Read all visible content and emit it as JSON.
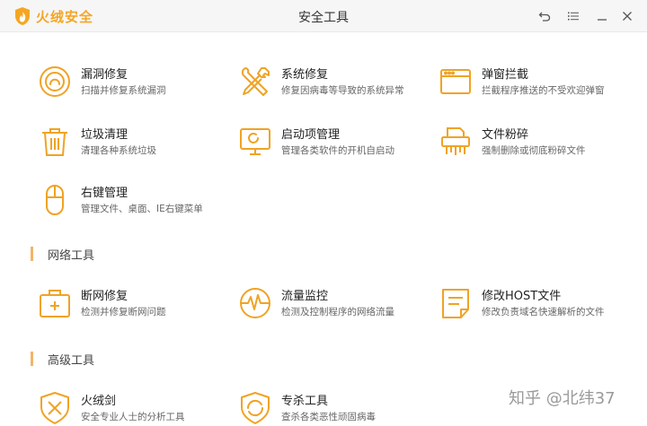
{
  "app": {
    "brand": "火绒安全",
    "title": "安全工具"
  },
  "colors": {
    "accent": "#f5a623",
    "icon_stroke": "#f0a324",
    "section_bar": "#f0b66a"
  },
  "window_controls": [
    "back-icon",
    "menu-icon",
    "minimize-icon",
    "close-icon"
  ],
  "sections": {
    "system": {
      "items": [
        {
          "name": "漏洞修复",
          "desc": "扫描并修复系统漏洞",
          "icon": "vulnerability-fix-icon"
        },
        {
          "name": "系统修复",
          "desc": "修复因病毒等导致的系统异常",
          "icon": "tools-icon"
        },
        {
          "name": "弹窗拦截",
          "desc": "拦截程序推送的不受欢迎弹窗",
          "icon": "popup-window-icon"
        },
        {
          "name": "垃圾清理",
          "desc": "清理各种系统垃圾",
          "icon": "trash-icon"
        },
        {
          "name": "启动项管理",
          "desc": "管理各类软件的开机自启动",
          "icon": "monitor-icon"
        },
        {
          "name": "文件粉碎",
          "desc": "强制删除或彻底粉碎文件",
          "icon": "shredder-icon"
        },
        {
          "name": "右键管理",
          "desc": "管理文件、桌面、IE右键菜单",
          "icon": "mouse-icon"
        }
      ]
    },
    "network": {
      "label": "网络工具",
      "items": [
        {
          "name": "断网修复",
          "desc": "检测并修复断网问题",
          "icon": "first-aid-kit-icon"
        },
        {
          "name": "流量监控",
          "desc": "检测及控制程序的网络流量",
          "icon": "traffic-monitor-icon"
        },
        {
          "name": "修改HOST文件",
          "desc": "修改负责域名快速解析的文件",
          "icon": "document-icon"
        }
      ]
    },
    "advanced": {
      "label": "高级工具",
      "items": [
        {
          "name": "火绒剑",
          "desc": "安全专业人士的分析工具",
          "icon": "sword-shield-icon"
        },
        {
          "name": "专杀工具",
          "desc": "查杀各类恶性顽固病毒",
          "icon": "kill-tool-shield-icon"
        }
      ]
    }
  },
  "watermark": "知乎 @北纬37"
}
